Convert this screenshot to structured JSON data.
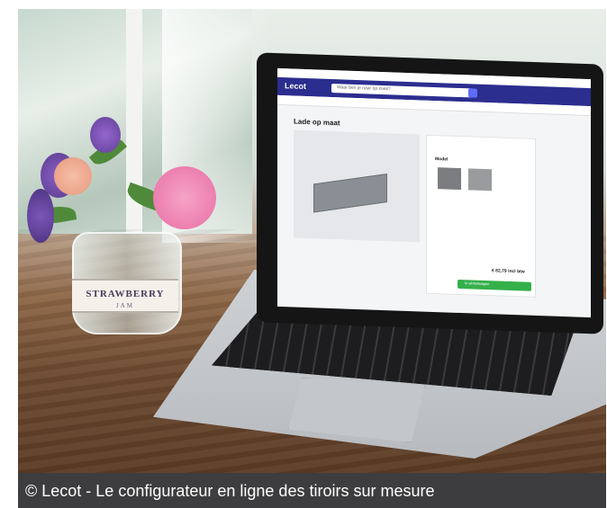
{
  "photo": {
    "vase_label": "STRAWBERRY",
    "vase_label_sub": "JAM"
  },
  "laptop_screen": {
    "site_logo": "Lecot",
    "search_placeholder": "Waar ben je naar op zoek?",
    "page_title": "Lade op maat",
    "panel_heading": "Model",
    "price": "€ 82,79 incl btw",
    "cart_button": "In winkelwagen"
  },
  "caption": {
    "text": "© Lecot - Le configurateur en ligne des tiroirs sur mesure"
  },
  "colors": {
    "caption_bg": "#3d3d3f",
    "site_header": "#2b2e8f",
    "cart_button": "#34b04a"
  }
}
